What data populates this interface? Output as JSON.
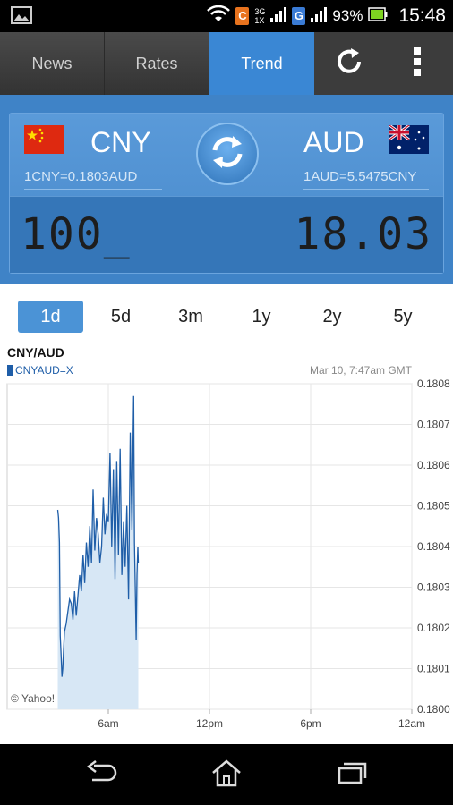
{
  "status_bar": {
    "left_icon": "image-notification-icon",
    "network_label_top": "3G",
    "network_label_bottom": "1X",
    "carrier_badge": "C",
    "g_badge": "G",
    "battery_percent": "93%",
    "time": "15:48"
  },
  "tabs": [
    {
      "label": "News"
    },
    {
      "label": "Rates"
    },
    {
      "label": "Trend"
    }
  ],
  "toolbar": {
    "refresh_icon": "refresh-icon",
    "menu_icon": "overflow-menu-icon"
  },
  "converter": {
    "from_code": "CNY",
    "from_rate": "1CNY=0.1803AUD",
    "to_code": "AUD",
    "to_rate": "1AUD=5.5475CNY",
    "from_amount": "100_",
    "to_amount": "18.03",
    "swap_icon": "swap-arrows-icon"
  },
  "ranges": [
    {
      "label": "1d",
      "active": true
    },
    {
      "label": "5d",
      "active": false
    },
    {
      "label": "3m",
      "active": false
    },
    {
      "label": "1y",
      "active": false
    },
    {
      "label": "2y",
      "active": false
    },
    {
      "label": "5y",
      "active": false
    }
  ],
  "chart_header": {
    "title": "CNY/AUD",
    "symbol": "CNYAUD=X",
    "timestamp": "Mar 10, 7:47am GMT",
    "credit": "© Yahoo!"
  },
  "chart_data": {
    "type": "area",
    "title": "CNY/AUD",
    "series": [
      {
        "name": "CNYAUD=X",
        "x_hours": [
          3.0,
          3.05,
          3.1,
          3.15,
          3.2,
          3.25,
          3.3,
          3.35,
          3.4,
          3.5,
          3.6,
          3.7,
          3.8,
          3.9,
          4.0,
          4.1,
          4.2,
          4.3,
          4.4,
          4.5,
          4.6,
          4.7,
          4.8,
          4.9,
          5.0,
          5.1,
          5.2,
          5.3,
          5.4,
          5.5,
          5.6,
          5.7,
          5.8,
          5.9,
          6.0,
          6.1,
          6.2,
          6.3,
          6.4,
          6.5,
          6.6,
          6.7,
          6.8,
          6.9,
          7.0,
          7.1,
          7.2,
          7.3,
          7.4,
          7.5,
          7.55,
          7.6,
          7.65,
          7.7,
          7.75,
          7.78
        ],
        "values": [
          0.18049,
          0.18047,
          0.18041,
          0.18018,
          0.18013,
          0.18008,
          0.1801,
          0.18015,
          0.18019,
          0.18021,
          0.18024,
          0.18027,
          0.18026,
          0.18022,
          0.18029,
          0.18023,
          0.18028,
          0.18033,
          0.18029,
          0.18038,
          0.18031,
          0.18041,
          0.18035,
          0.18045,
          0.18036,
          0.18054,
          0.18039,
          0.18047,
          0.18043,
          0.18036,
          0.1804,
          0.18052,
          0.18043,
          0.18048,
          0.18046,
          0.18063,
          0.1804,
          0.18059,
          0.18032,
          0.18061,
          0.18038,
          0.18064,
          0.18033,
          0.18046,
          0.18035,
          0.1805,
          0.18027,
          0.18068,
          0.18044,
          0.18077,
          0.18041,
          0.1803,
          0.18017,
          0.18033,
          0.1804,
          0.18036
        ]
      }
    ],
    "x_ticks": [
      {
        "label": "6am",
        "hour": 6
      },
      {
        "label": "12pm",
        "hour": 12
      },
      {
        "label": "6pm",
        "hour": 18
      },
      {
        "label": "12am",
        "hour": 24
      }
    ],
    "y_ticks": [
      "0.1808",
      "0.1807",
      "0.1806",
      "0.1805",
      "0.1804",
      "0.1803",
      "0.1802",
      "0.1801",
      "0.1800"
    ],
    "ylim": [
      0.18,
      0.1808
    ],
    "xlim_hours": [
      0,
      24
    ],
    "grid": true,
    "line_color": "#1f5ea8",
    "fill_color": "#d7e7f5"
  },
  "nav": {
    "back_icon": "back-icon",
    "home_icon": "home-icon",
    "recents_icon": "recent-apps-icon"
  }
}
